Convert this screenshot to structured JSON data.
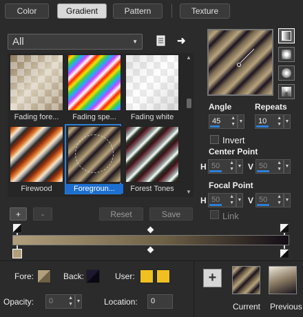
{
  "tabs": [
    {
      "label": "Color"
    },
    {
      "label": "Gradient"
    },
    {
      "label": "Pattern"
    },
    {
      "label": "Texture"
    }
  ],
  "category": {
    "selected": "All"
  },
  "gradients": [
    {
      "label": "Fading fore..."
    },
    {
      "label": "Fading spe..."
    },
    {
      "label": "Fading white"
    },
    {
      "label": "Firewood"
    },
    {
      "label": "Foregroun..."
    },
    {
      "label": "Forest Tones"
    }
  ],
  "editor": {
    "add_label": "+",
    "remove_label": "-",
    "reset_label": "Reset",
    "save_label": "Save"
  },
  "controls": {
    "angle_label": "Angle",
    "angle_value": "45",
    "repeats_label": "Repeats",
    "repeats_value": "10",
    "invert_label": "Invert",
    "center_label": "Center Point",
    "center_h_label": "H",
    "center_h_value": "50",
    "center_v_label": "V",
    "center_v_value": "50",
    "focal_label": "Focal Point",
    "focal_h_label": "H",
    "focal_h_value": "50",
    "focal_v_label": "V",
    "focal_v_value": "50",
    "link_label": "Link"
  },
  "colors": {
    "fore_label": "Fore:",
    "back_label": "Back:",
    "user_label": "User:",
    "opacity_label": "Opacity:",
    "opacity_value": "0",
    "location_label": "Location:",
    "location_value": "0",
    "user_color": "#f0c020",
    "gradient_start": "#b19f7c",
    "gradient_end": "#130d16"
  },
  "preview": {
    "current_label": "Current",
    "previous_label": "Previous"
  }
}
